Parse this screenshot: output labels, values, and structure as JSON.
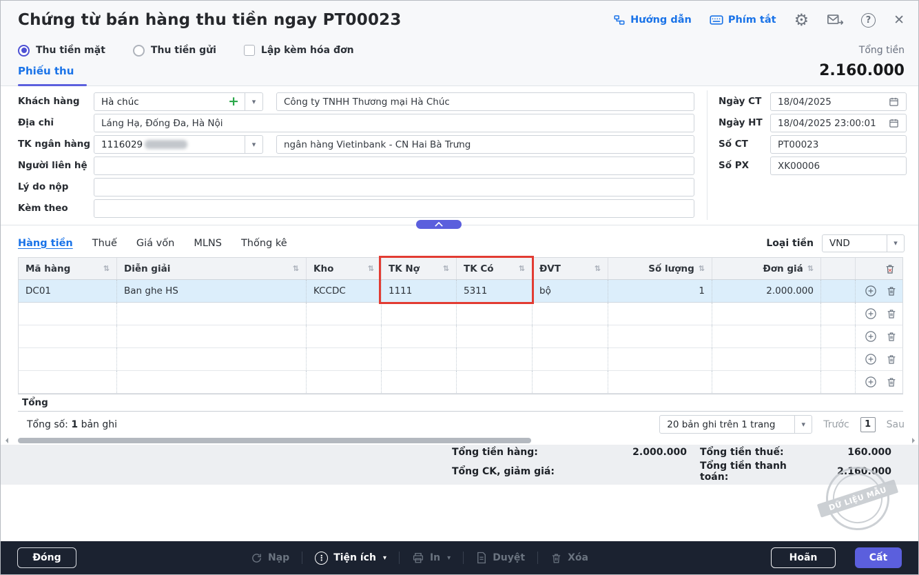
{
  "window": {
    "title": "Chứng từ bán hàng thu tiền ngay PT00023",
    "guide_link": "Hướng dẫn",
    "shortcut_link": "Phím tắt"
  },
  "payment_options": {
    "cash": "Thu tiền mặt",
    "bank": "Thu tiền gửi",
    "with_invoice": "Lập kèm hóa đơn"
  },
  "total_box": {
    "label": "Tổng tiền",
    "value": "2.160.000"
  },
  "doc_tab": "Phiếu thu",
  "form": {
    "customer_label": "Khách hàng",
    "customer_code": "Hà chúc",
    "customer_name": "Công ty TNHH Thương mại Hà Chúc",
    "address_label": "Địa chỉ",
    "address": "Láng Hạ, Đống Đa, Hà Nội",
    "bank_label": "TK ngân hàng",
    "bank_account_visible": "1116029",
    "bank_name": "ngân hàng Vietinbank  -  CN Hai Bà Trưng",
    "contact_label": "Người liên hệ",
    "reason_label": "Lý do nộp",
    "attach_label": "Kèm theo",
    "date_ct_label": "Ngày CT",
    "date_ct": "18/04/2025",
    "date_ht_label": "Ngày HT",
    "date_ht": "18/04/2025 23:00:01",
    "doc_no_label": "Số CT",
    "doc_no": "PT00023",
    "px_no_label": "Số PX",
    "px_no": "XK00006"
  },
  "detail_tabs": [
    "Hàng tiền",
    "Thuế",
    "Giá vốn",
    "MLNS",
    "Thống kê"
  ],
  "currency": {
    "label": "Loại tiền",
    "value": "VND"
  },
  "table": {
    "headers": [
      "Mã hàng",
      "Diễn giải",
      "Kho",
      "TK Nợ",
      "TK Có",
      "ĐVT",
      "Số lượng",
      "Đơn giá"
    ],
    "row": {
      "code": "DC01",
      "desc": "Ban ghe HS",
      "warehouse": "KCCDC",
      "debit": "1111",
      "credit": "5311",
      "unit": "bộ",
      "qty": "1",
      "price": "2.000.000"
    },
    "footer_label": "Tổng"
  },
  "pagination": {
    "count_prefix": "Tổng số:",
    "count": "1",
    "count_suffix": "bản ghi",
    "page_size": "20 bản ghi trên 1 trang",
    "prev": "Trước",
    "page": "1",
    "next": "Sau"
  },
  "totals": {
    "goods_label": "Tổng tiền hàng:",
    "goods": "2.000.000",
    "tax_label": "Tổng tiền thuế:",
    "tax": "160.000",
    "discount_label": "Tổng CK, giảm giá:",
    "discount": "",
    "grand_label": "Tổng tiền thanh toán:",
    "grand": "2.160.000"
  },
  "watermark": "DỮ LIỆU MẪU",
  "footer_bar": {
    "close": "Đóng",
    "reload": "Nạp",
    "utilities": "Tiện ích",
    "print": "In",
    "approve": "Duyệt",
    "delete": "Xóa",
    "postpone": "Hoãn",
    "save": "Cất"
  },
  "icons": {
    "settings": "⚙",
    "help": "?",
    "close": "✕",
    "sort": "⇅",
    "dropdown": "▾",
    "add": "+",
    "more": "⋮"
  },
  "colors": {
    "accent": "#5b5fdd",
    "link_blue": "#1a73e8",
    "highlight_box": "#e23b32",
    "row_highlight": "#dceefb",
    "footer_bg": "#1b2230"
  }
}
